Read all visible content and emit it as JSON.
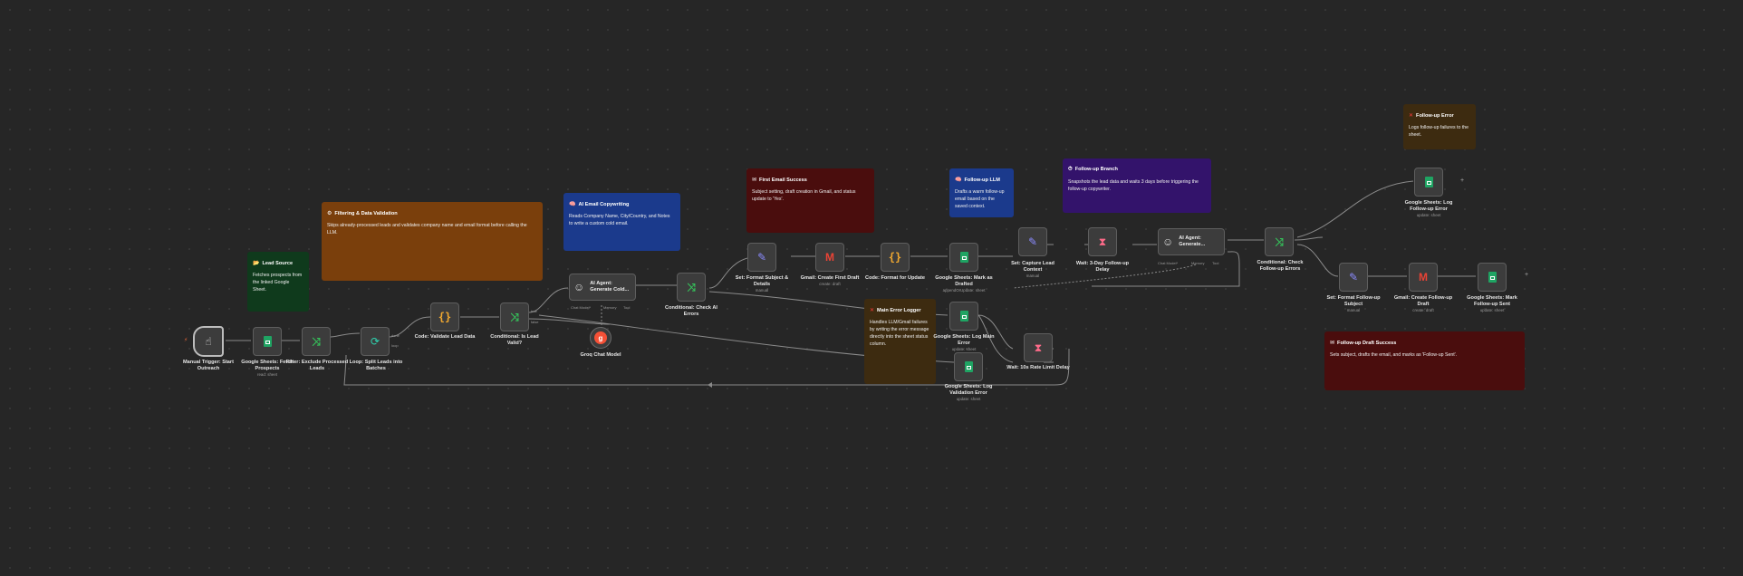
{
  "stickies": [
    {
      "id": "lead-source",
      "title": "Lead Source",
      "icon": "📂",
      "body": "Fetches prospects from the linked Google Sheet.",
      "color": "#0f3a1c"
    },
    {
      "id": "filtering",
      "title": "Filtering & Data Validation",
      "icon": "⚙",
      "body": "Skips already-processed leads and validates company name and email format before calling the LLM.",
      "color": "#7a3f0c"
    },
    {
      "id": "ai-copywriting",
      "title": "AI Email Copywriting",
      "icon": "🧠",
      "body": "Reads Company Name, City/Country, and Notes to write a custom cold email.",
      "color": "#1b3a8c"
    },
    {
      "id": "first-email-success",
      "title": "First Email Success",
      "icon": "✉",
      "body": "Subject setting, draft creation in Gmail, and status update to 'Yes'.",
      "color": "#4a0d0d"
    },
    {
      "id": "main-error-logger",
      "title": "Main Error Logger",
      "icon": "✕",
      "body": "Handles LLM/Gmail failures by writing the error message directly into the sheet status column.",
      "color": "#3d2b10"
    },
    {
      "id": "follow-up-llm",
      "title": "Follow-up LLM",
      "icon": "🧠",
      "body": "Drafts a warm follow-up email based on the saved context.",
      "color": "#1b3a8c"
    },
    {
      "id": "follow-up-branch",
      "title": "Follow-up Branch",
      "icon": "⏱",
      "body": "Snapshots the lead data and waits 3 days before triggering the follow-up copywriter.",
      "color": "#33136b"
    },
    {
      "id": "follow-up-error",
      "title": "Follow-up Error",
      "icon": "✕",
      "body": "Logs follow-up failures to the sheet.",
      "color": "#3d2b10"
    },
    {
      "id": "follow-up-draft-success",
      "title": "Follow-up Draft Success",
      "icon": "✉",
      "body": "Sets subject, drafts the email, and marks as 'Follow-up Sent'.",
      "color": "#4a0d0d"
    }
  ],
  "nodes": [
    {
      "id": "manual-trigger",
      "label": "Manual Trigger: Start Outreach",
      "sub": "",
      "icon": "touch"
    },
    {
      "id": "sheets-fetch",
      "label": "Google Sheets: Fetch Prospects",
      "sub": "read: sheet",
      "icon": "sheets"
    },
    {
      "id": "filter",
      "label": "Filter: Exclude Processed Leads",
      "sub": "",
      "icon": "filter"
    },
    {
      "id": "loop",
      "label": "Loop: Split Leads into Batches",
      "sub": "",
      "icon": "loop"
    },
    {
      "id": "code-validate",
      "label": "Code: Validate Lead Data",
      "sub": "",
      "icon": "code"
    },
    {
      "id": "if-valid",
      "label": "Conditional: Is Lead Valid?",
      "sub": "",
      "icon": "if"
    },
    {
      "id": "ai-agent-1",
      "label": "AI Agent: Generate Cold...",
      "sub": "",
      "icon": "robot"
    },
    {
      "id": "groq",
      "label": "Groq Chat Model",
      "sub": "",
      "icon": "groq"
    },
    {
      "id": "if-ai-errors",
      "label": "Conditional: Check AI Errors",
      "sub": "",
      "icon": "if"
    },
    {
      "id": "set-subject",
      "label": "Set: Format Subject & Details",
      "sub": "manual",
      "icon": "set"
    },
    {
      "id": "gmail-draft",
      "label": "Gmail: Create First Draft",
      "sub": "create: draft",
      "icon": "gmail"
    },
    {
      "id": "code-update",
      "label": "Code: Format for Update",
      "sub": "",
      "icon": "code"
    },
    {
      "id": "sheets-mark-drafted",
      "label": "Google Sheets: Mark as Drafted",
      "sub": "appendOrUpdate: sheet",
      "icon": "sheets"
    },
    {
      "id": "sheets-log-main",
      "label": "Google Sheets: Log Main Error",
      "sub": "update: sheet",
      "icon": "sheets"
    },
    {
      "id": "wait-rate",
      "label": "Wait: 10s Rate Limit Delay",
      "sub": "",
      "icon": "wait"
    },
    {
      "id": "sheets-log-validation",
      "label": "Google Sheets: Log Validation Error",
      "sub": "update: sheet",
      "icon": "sheets"
    },
    {
      "id": "set-capture",
      "label": "Set: Capture Lead Context",
      "sub": "manual",
      "icon": "set"
    },
    {
      "id": "wait-3day",
      "label": "Wait: 3-Day Follow-up Delay",
      "sub": "",
      "icon": "wait"
    },
    {
      "id": "ai-agent-2",
      "label": "AI Agent: Generate...",
      "sub": "",
      "icon": "robot"
    },
    {
      "id": "if-followup-errors",
      "label": "Conditional: Check Follow-up Errors",
      "sub": "",
      "icon": "if"
    },
    {
      "id": "sheets-log-followup",
      "label": "Google Sheets: Log Follow-up Error",
      "sub": "update: sheet",
      "icon": "sheets"
    },
    {
      "id": "set-followup-subject",
      "label": "Set: Format Follow-up Subject",
      "sub": "manual",
      "icon": "set"
    },
    {
      "id": "gmail-followup",
      "label": "Gmail: Create Follow-up Draft",
      "sub": "create: draft",
      "icon": "gmail"
    },
    {
      "id": "sheets-mark-sent",
      "label": "Google Sheets: Mark Follow-up Sent",
      "sub": "update: sheet",
      "icon": "sheets"
    }
  ],
  "ports": {
    "chat_model": "Chat Model*",
    "memory": "Memory",
    "tool": "Tool",
    "true": "true",
    "false": "false",
    "loop": "loop",
    "done": "done"
  },
  "icons": {
    "touch": "☝",
    "sheets": "sheets-icon",
    "filter": "⤨",
    "if": "⤨",
    "loop": "⟳",
    "code": "{ }",
    "set": "✎",
    "gmail": "M",
    "wait": "⧗",
    "robot": "☺",
    "groq": "g"
  },
  "colors": {
    "canvas": "#262626",
    "node_bg": "#3c3c3c",
    "edge": "#8a8a8a",
    "trigger_marker": "#ff6d3a"
  }
}
